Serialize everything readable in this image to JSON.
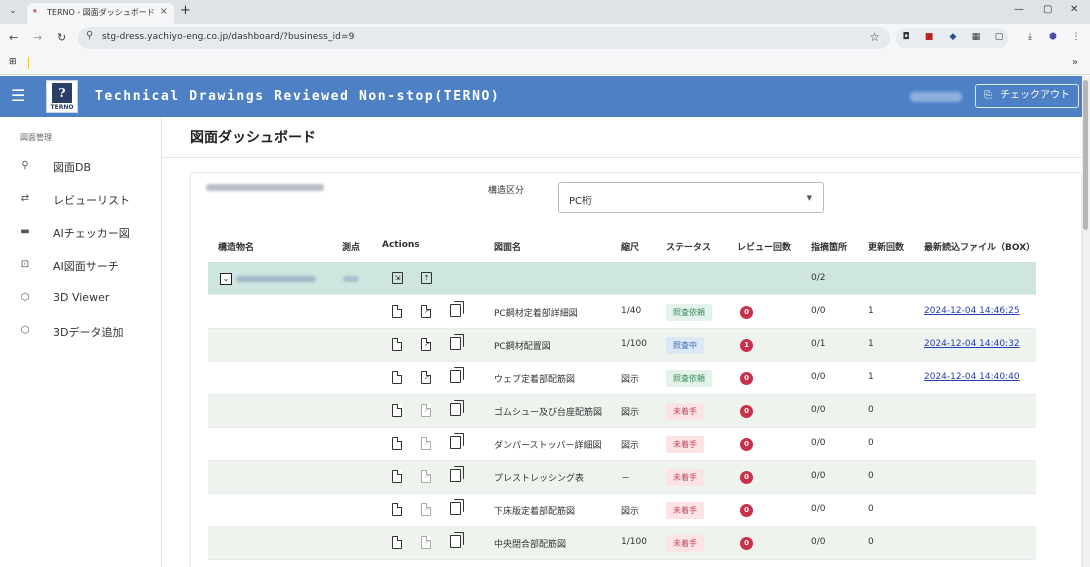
{
  "browser": {
    "tab_title": "TERNO - 図面ダッシュボード",
    "tab_favicon": "ᴿ",
    "new_tab": "+",
    "url": "stg-dress.yachiyo-eng.co.jp/dashboard/?business_id=9",
    "bookmarks_more": "»"
  },
  "app": {
    "title": "Technical Drawings Reviewed Non-stop(TERNO)",
    "logo_text": "TERNO",
    "checkout_label": "チェックアウト"
  },
  "sidebar": {
    "section": "図面管理",
    "items": [
      {
        "label": "図面DB",
        "icon": "search-icon"
      },
      {
        "label": "レビューリスト",
        "icon": "compare-icon"
      },
      {
        "label": "AIチェッカー図",
        "icon": "folder-icon"
      },
      {
        "label": "AI図面サーチ",
        "icon": "image-search-icon"
      },
      {
        "label": "3D Viewer",
        "icon": "cube-icon"
      },
      {
        "label": "3Dデータ追加",
        "icon": "cube-add-icon"
      }
    ]
  },
  "page": {
    "title": "図面ダッシュボード",
    "kozo_label": "構造区分",
    "kozo_value": "PC桁"
  },
  "table": {
    "headers": [
      "構造物名",
      "測点",
      "Actions",
      "図面名",
      "縮尺",
      "ステータス",
      "レビュー回数",
      "指摘箇所",
      "更新回数",
      "最新読込ファイル（BOX）"
    ],
    "group_row": {
      "shiteki": "0/2"
    },
    "rows": [
      {
        "name": "PC鋼材定着部詳細図",
        "scale": "1/40",
        "status": "照査依頼",
        "status_type": "request",
        "reviews": "0",
        "shiteki": "0/0",
        "updates": "1",
        "file": "2024-12-04 14:46:25",
        "edit_active": true
      },
      {
        "name": "PC鋼材配置図",
        "scale": "1/100",
        "status": "照査中",
        "status_type": "progress",
        "reviews": "1",
        "shiteki": "0/1",
        "updates": "1",
        "file": "2024-12-04 14:40:32",
        "edit_active": true
      },
      {
        "name": "ウェブ定着部配筋図",
        "scale": "図示",
        "status": "照査依頼",
        "status_type": "request",
        "reviews": "0",
        "shiteki": "0/0",
        "updates": "1",
        "file": "2024-12-04 14:40:40",
        "edit_active": true
      },
      {
        "name": "ゴムシュー及び台座配筋図",
        "scale": "図示",
        "status": "未着手",
        "status_type": "todo",
        "reviews": "0",
        "shiteki": "0/0",
        "updates": "0",
        "file": "",
        "edit_active": false
      },
      {
        "name": "ダンパーストッパー詳細図",
        "scale": "図示",
        "status": "未着手",
        "status_type": "todo",
        "reviews": "0",
        "shiteki": "0/0",
        "updates": "0",
        "file": "",
        "edit_active": false
      },
      {
        "name": "プレストレッシング表",
        "scale": "－",
        "status": "未着手",
        "status_type": "todo",
        "reviews": "0",
        "shiteki": "0/0",
        "updates": "0",
        "file": "",
        "edit_active": false
      },
      {
        "name": "下床版定着部配筋図",
        "scale": "図示",
        "status": "未着手",
        "status_type": "todo",
        "reviews": "0",
        "shiteki": "0/0",
        "updates": "0",
        "file": "",
        "edit_active": false
      },
      {
        "name": "中央閉合部配筋図",
        "scale": "1/100",
        "status": "未着手",
        "status_type": "todo",
        "reviews": "0",
        "shiteki": "0/0",
        "updates": "0",
        "file": "",
        "edit_active": false
      }
    ]
  },
  "colors": {
    "appbar": "#4e80c6",
    "status_request_bg": "#e2f3ea",
    "status_request_fg": "#3b8a5c",
    "status_progress_bg": "#dde8f7",
    "status_progress_fg": "#3a6cb5",
    "status_todo_bg": "#fbe3e6",
    "status_todo_fg": "#c04a5c",
    "badge": "#c8314a",
    "link": "#2541b2"
  }
}
